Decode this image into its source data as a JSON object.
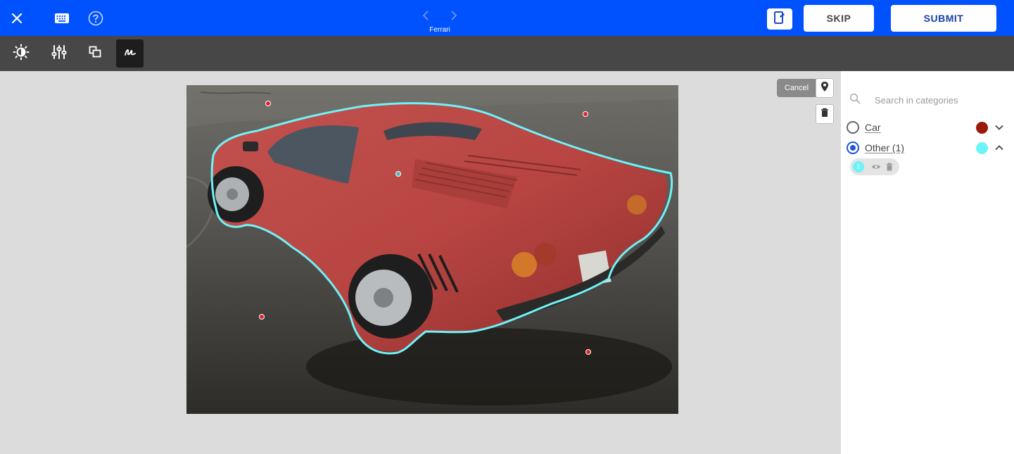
{
  "header": {
    "image_name": "Ferrari",
    "skip_label": "SKIP",
    "submit_label": "SUBMIT",
    "icons": [
      "close-icon",
      "keyboard-icon",
      "help-icon",
      "chevron-left-icon",
      "chevron-right-icon",
      "notes-icon"
    ]
  },
  "toolbar": {
    "tools": [
      "brightness-icon",
      "adjust-sliders-icon",
      "layers-icon",
      "freehand-draw-icon"
    ],
    "active_tool": "freehand-draw-icon"
  },
  "canvas": {
    "cancel_label": "Cancel",
    "icons": [
      "location-pin-icon",
      "trash-icon"
    ]
  },
  "sidebar": {
    "search_placeholder": "Search in categories",
    "categories": [
      {
        "label": "Car",
        "color": "#9b1a07",
        "selected": false,
        "expanded": false
      },
      {
        "label": "Other (1)",
        "color": "#6ef3f8",
        "selected": true,
        "expanded": true
      }
    ],
    "instance": {
      "number": "1"
    }
  },
  "colors": {
    "brand_blue": "#0052ff",
    "toolbar_gray": "#474747",
    "outline_cyan": "#6ef3f8",
    "point_red": "#e0232a"
  }
}
